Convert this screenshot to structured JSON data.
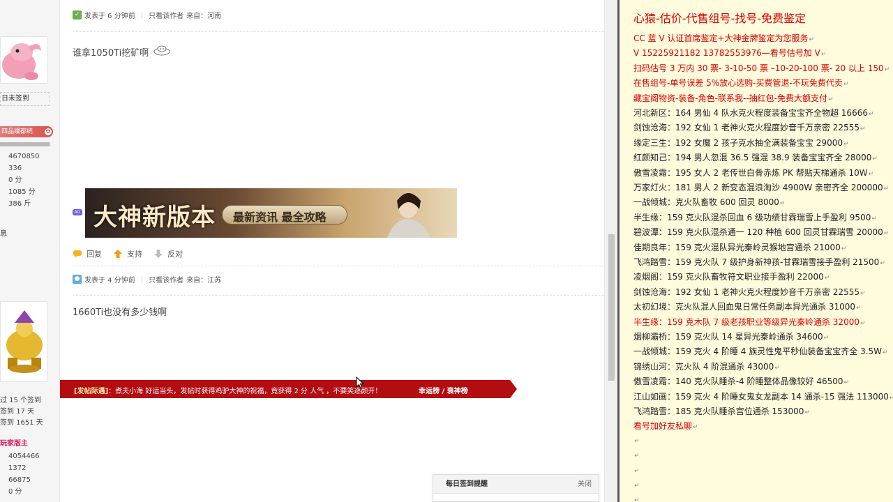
{
  "left_col": {
    "unsigned": "日未签到",
    "rank_badge": "四品缫都统",
    "exp_fill_fraction": 0.98,
    "stats": [
      "4670850",
      "336",
      "0 分",
      "1085 分",
      "386 斤"
    ],
    "xi": "息",
    "sign_info": [
      "过 15 个签到",
      "签到 17 天",
      "签到 1651 天"
    ],
    "mod_title": "玩家版主",
    "stats2": [
      "4054466",
      "1372",
      "66875",
      "0 分"
    ]
  },
  "posts": [
    {
      "meta": {
        "time": "发表于 6 分钟前",
        "author_only": "只看该作者",
        "from": "来自：河南"
      },
      "body": "谁拿1050Ti挖矿啊"
    },
    {
      "meta": {
        "time": "发表于 4 分钟前",
        "author_only": "只看该作者",
        "from": "来自：江苏"
      },
      "body": "1660Ti也没有多少钱啊"
    }
  ],
  "ad": {
    "tag": "AD",
    "big": "大神新版本",
    "sub": "最新资讯  最全攻略"
  },
  "actions": {
    "reply": "回复",
    "support": "支持",
    "oppose": "反对"
  },
  "notice": {
    "prefix": "[发帖际遇]",
    "text": "：煮夫小海 好运当头，发帖时获得鸡驴大神的祝福，竟获得 2 分 人气 ，不要笑逐颜开！",
    "link": "幸运榜 / 衰神榜"
  },
  "signin": {
    "title": "每日签到提醒",
    "close": "关闭"
  },
  "notepad": {
    "title": "心猿-估价-代售组号-找号-免费鉴定",
    "lines": [
      {
        "text": "CC 蓝 V 认证首席鉴定+大神金牌鉴定为您服务",
        "red": true
      },
      {
        "text": "V 15225921182     13782553976—看号估号加 V",
        "red": true
      },
      {
        "text": "扫码估号 3 万内 30 票- 3-10-50 票  –10-20-100 票- 20 以上 150",
        "red": true
      },
      {
        "text": "在售组号-单号误差 5%放心选购-买费管退-不玩免费代卖",
        "red": true
      },
      {
        "text": "藏宝阁物资-装备-角色-联系我--抽红包-免费大额支付",
        "red": true
      },
      {
        "text": "河北新区：164 男仙 4 队水克火程度装备宝宝齐全物超 16666",
        "red": false
      },
      {
        "text": "剑蚀沧海：192 女仙 1 老神火克火程度妙音千万亲密 22555",
        "red": false
      },
      {
        "text": "缘定三生：192 女魔 2 孩子克水抽全满装备宝宝 29000",
        "red": false
      },
      {
        "text": "红颜知己：194 男人忽混 36.5 强混 38.9 装备宝宝齐全 28000",
        "red": false
      },
      {
        "text": "傲雪凌霜：195 女人 2 老传世白骨赤炼 PK 帮贴天梯通杀 10W",
        "red": false
      },
      {
        "text": "万家灯火：181 男人 2 新变态混浪淘沙 4900W 亲密齐全 200000",
        "red": false
      },
      {
        "text": "一战倾城：克火队畜牧 600 回灵 8000",
        "red": false
      },
      {
        "text": "半生缘：159 克火队混杀回血 6 级功绩甘霖瑞雪上手盈利 9500",
        "red": false
      },
      {
        "text": "碧波潭：159 克火队混杀通一 120 种植 600 回灵甘霖瑞雪 20000",
        "red": false
      },
      {
        "text": "佳期良年：159 克火混队异光秦岭灵猴地宫通杀 21000",
        "red": false
      },
      {
        "text": "飞鸿踏雪：159 克火队 7 级护身新神孩-甘霖瑞雪接手盈利 21500",
        "red": false
      },
      {
        "text": "凌烟阁：159 克火队畜牧符文职业接手盈利 22000",
        "red": false
      },
      {
        "text": "剑蚀沧海：192 女仙 1 老神火克火程度妙音千万亲密 22555",
        "red": false
      },
      {
        "text": "太初幻境：克火队混人回血鬼日常任务副本异光通杀 31000",
        "red": false
      },
      {
        "text": "半生缘：159 克木队 7 级老孩职业等级异光秦岭通杀 32000",
        "red": true
      },
      {
        "text": "烟柳灞桥：159 克火队 14 星异光秦岭通杀 34600",
        "red": false
      },
      {
        "text": "一战倾城：159 克火 4 阶睡 4 族灵性鬼平秒仙装备宝宝齐全 3.5W",
        "red": false
      },
      {
        "text": "锦绣山河：克火队 4 阶混通杀 43000",
        "red": false
      },
      {
        "text": "傲雪凌霜：140 克火队睡杀-4 阶睡整体品像较好 46500",
        "red": false
      },
      {
        "text": "江山如画：159 克火 4 阶睡女鬼女龙副本 14 通杀-15 强法 113000",
        "red": false
      },
      {
        "text": "飞鸿踏雪：185 克火队睡杀宫位通杀 153000",
        "red": false
      },
      {
        "text": "看号加好友私聊",
        "red": true
      },
      {
        "text": "",
        "red": false
      },
      {
        "text": "",
        "red": false
      },
      {
        "text": "",
        "red": false
      },
      {
        "text": "",
        "red": false
      },
      {
        "text": "",
        "red": false
      }
    ]
  },
  "mark_glyph": "↵",
  "colors": {
    "accent_red": "#e00000",
    "notice_bar": "#b30d12",
    "notepad_bg": "#fffbdd"
  }
}
